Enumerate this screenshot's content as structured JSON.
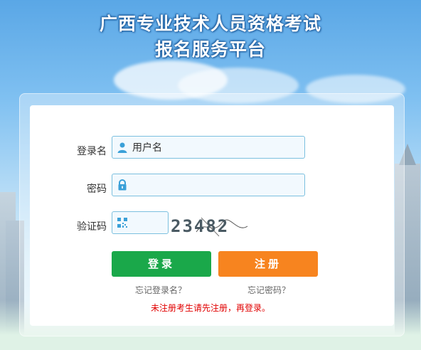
{
  "header": {
    "title_line1": "广西专业技术人员资格考试",
    "title_line2": "报名服务平台"
  },
  "form": {
    "username_label": "登录名",
    "username_value": "用户名",
    "password_label": "密码",
    "password_value": "",
    "captcha_label": "验证码",
    "captcha_value": "",
    "captcha_text": "23482"
  },
  "buttons": {
    "login": "登录",
    "register": "注册"
  },
  "links": {
    "forgot_username": "忘记登录名？",
    "forgot_password": "忘记密码？"
  },
  "notice": "未注册考生请先注册，再登录。",
  "colors": {
    "login_button": "#1aa84a",
    "register_button": "#f7841f",
    "field_border": "#7cc0df",
    "notice": "#e10000"
  }
}
